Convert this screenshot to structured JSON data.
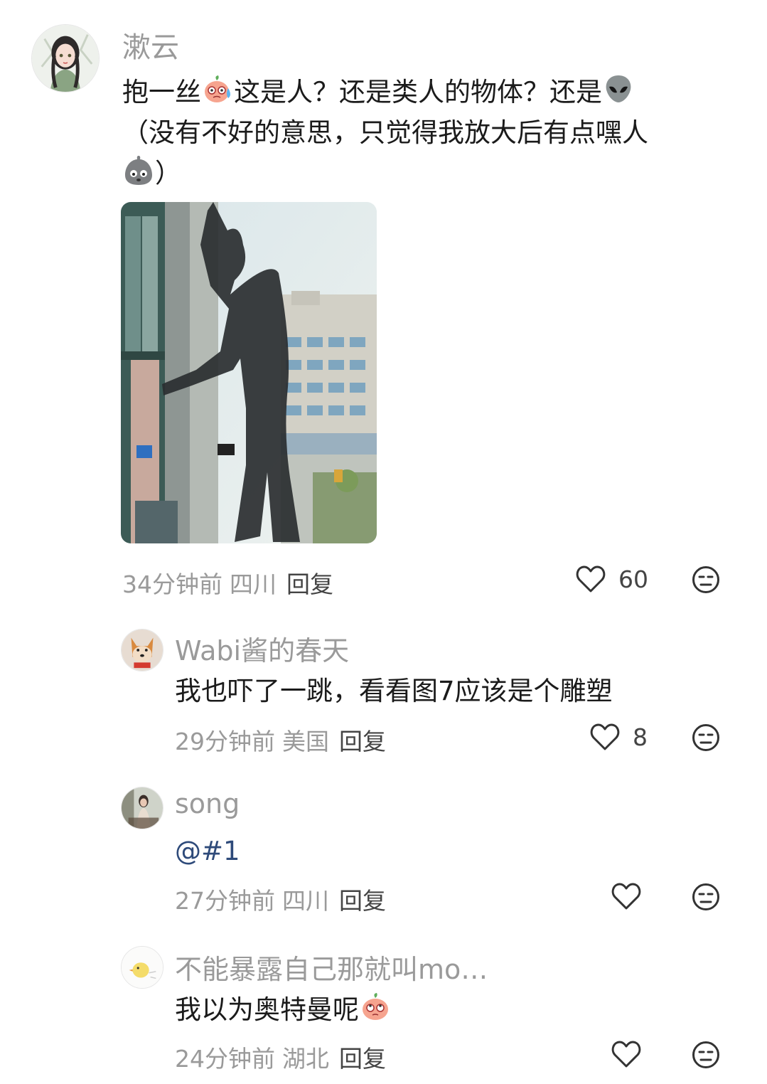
{
  "comments": [
    {
      "username": "漱云",
      "text_a": "抱一丝",
      "text_b": "这是人？还是类人的物体？还是",
      "text_c": "（没有不好的意思，只觉得我放大后有点嘿人",
      "text_d": "）",
      "time": "34分钟前",
      "location": "四川",
      "reply": "回复",
      "likes": "60"
    },
    {
      "username": "Wabi酱的春天",
      "text": "我也吓了一跳，看看图7应该是个雕塑",
      "time": "29分钟前",
      "location": "美国",
      "reply": "回复",
      "likes": "8"
    },
    {
      "username": "song",
      "text": "@#1",
      "time": "27分钟前",
      "location": "四川",
      "reply": "回复",
      "likes": ""
    },
    {
      "username": "不能暴露自己那就叫mo…",
      "text": "我以为奥特曼呢",
      "time": "24分钟前",
      "location": "湖北",
      "reply": "回复",
      "likes": ""
    }
  ],
  "icons": {
    "like": "heart-outline-icon",
    "dislike": "unamused-face-icon",
    "emoji_sweat": "peach-sweat-emoji",
    "emoji_alien": "alien-emoji",
    "emoji_ghost": "gray-blob-emoji",
    "emoji_peach": "peach-eyes-up-emoji"
  },
  "colors": {
    "username": "#9a9a9a",
    "meta": "#9a9a9a",
    "reply": "#444444",
    "mention": "#2e4a7a"
  }
}
